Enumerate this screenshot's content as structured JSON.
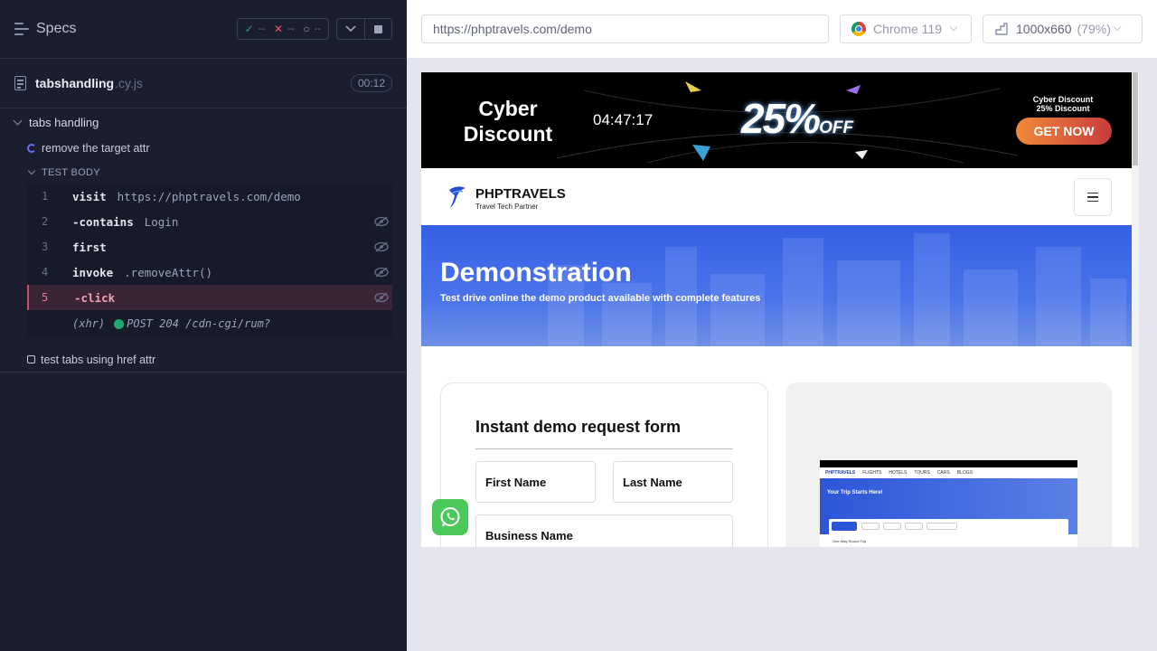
{
  "reporter": {
    "header": {
      "title": "Specs",
      "passed": "--",
      "failed": "--",
      "pending": "--"
    },
    "spec": {
      "name": "tabshandling",
      "ext": ".cy.js",
      "duration": "00:12"
    },
    "suite": {
      "title": "tabs handling"
    },
    "tests": [
      {
        "title": "remove the target attr",
        "state": "running"
      },
      {
        "title": "test tabs using href attr",
        "state": "pending"
      }
    ],
    "test_body_label": "TEST BODY",
    "commands": [
      {
        "num": "1",
        "name": "visit",
        "arg": "https://phptravels.com/demo"
      },
      {
        "num": "2",
        "name": "-contains",
        "arg": "Login"
      },
      {
        "num": "3",
        "name": "first",
        "arg": ""
      },
      {
        "num": "4",
        "name": "invoke",
        "arg": ".removeAttr()"
      },
      {
        "num": "5",
        "name": "-click",
        "arg": ""
      }
    ],
    "xhr": {
      "label": "(xhr)",
      "text": "POST 204 /cdn-cgi/rum?"
    }
  },
  "topbar": {
    "url": "https://phptravels.com/demo",
    "browser": "Chrome 119",
    "viewport": "1000x660",
    "scale": "(79%)"
  },
  "aut": {
    "promo": {
      "title": "Cyber Discount",
      "countdown": "04:47:17",
      "percent": "25%",
      "off": "OFF",
      "small_line1": "Cyber Discount",
      "small_line2": "25% Discount",
      "cta": "GET NOW"
    },
    "nav": {
      "brand": "PHPTRAVELS",
      "tagline": "Travel Tech Partner"
    },
    "hero": {
      "title": "Demonstration",
      "subtitle": "Test drive online the demo product available with complete features"
    },
    "form": {
      "title": "Instant demo request form",
      "first_name": "First Name",
      "last_name": "Last Name",
      "business_name": "Business Name"
    },
    "mini": {
      "hero_title": "Your Trip Starts Here!",
      "nav_brand": "PHPTRAVELS",
      "nav_items": [
        "FLIGHTS",
        "HOTELS",
        "TOURS",
        "CARS",
        "BLOGS"
      ],
      "options": "One Way   Round Trip"
    }
  },
  "colors": {
    "reporter_bg": "#1b1e2e",
    "active_cmd": "#3a2537",
    "hero_blue": "#3560e6",
    "whatsapp": "#4ac95a"
  }
}
